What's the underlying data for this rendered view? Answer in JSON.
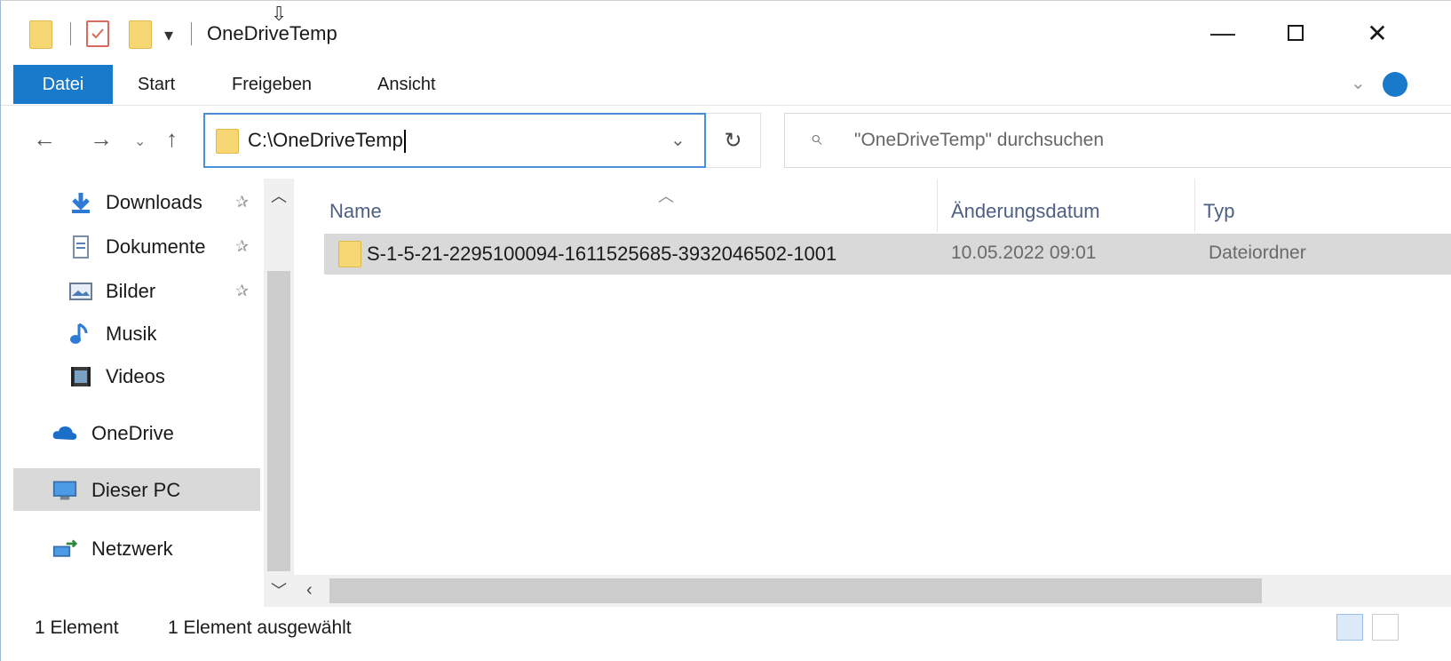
{
  "window": {
    "title": "OneDriveTemp",
    "minimize_icon": "minimize-icon",
    "maximize_icon": "maximize-icon",
    "close_icon": "close-icon"
  },
  "quick_access": {
    "dropdown_glyph": "▾"
  },
  "ribbon": {
    "tabs": [
      {
        "label": "Datei"
      },
      {
        "label": "Start"
      },
      {
        "label": "Freigeben"
      },
      {
        "label": "Ansicht"
      }
    ]
  },
  "address": {
    "path": "C:\\OneDriveTemp"
  },
  "search": {
    "placeholder": "\"OneDriveTemp\" durchsuchen"
  },
  "navigation": {
    "items": [
      {
        "label": "Downloads",
        "icon": "download-arrow-icon",
        "pinned": true
      },
      {
        "label": "Dokumente",
        "icon": "document-icon",
        "pinned": true
      },
      {
        "label": "Bilder",
        "icon": "pictures-icon",
        "pinned": true
      },
      {
        "label": "Musik",
        "icon": "music-note-icon",
        "pinned": false
      },
      {
        "label": "Videos",
        "icon": "video-icon",
        "pinned": false
      },
      {
        "label": "OneDrive",
        "icon": "cloud-icon",
        "pinned": false
      },
      {
        "label": "Dieser PC",
        "icon": "computer-icon",
        "pinned": false,
        "selected": true
      },
      {
        "label": "Netzwerk",
        "icon": "network-icon",
        "pinned": false
      }
    ]
  },
  "columns": [
    {
      "label": "Name"
    },
    {
      "label": "Änderungsdatum"
    },
    {
      "label": "Typ"
    }
  ],
  "files": [
    {
      "name": "S-1-5-21-2295100094-1611525685-3932046502-1001",
      "modified": "10.05.2022 09:01",
      "type": "Dateiordner",
      "selected": true
    }
  ],
  "status": {
    "count": "1 Element",
    "selection": "1 Element ausgewählt"
  },
  "colors": {
    "accent": "#1979ca",
    "folder": "#f7d774",
    "selection": "#d9d9d9",
    "column_header": "#4d6083"
  }
}
